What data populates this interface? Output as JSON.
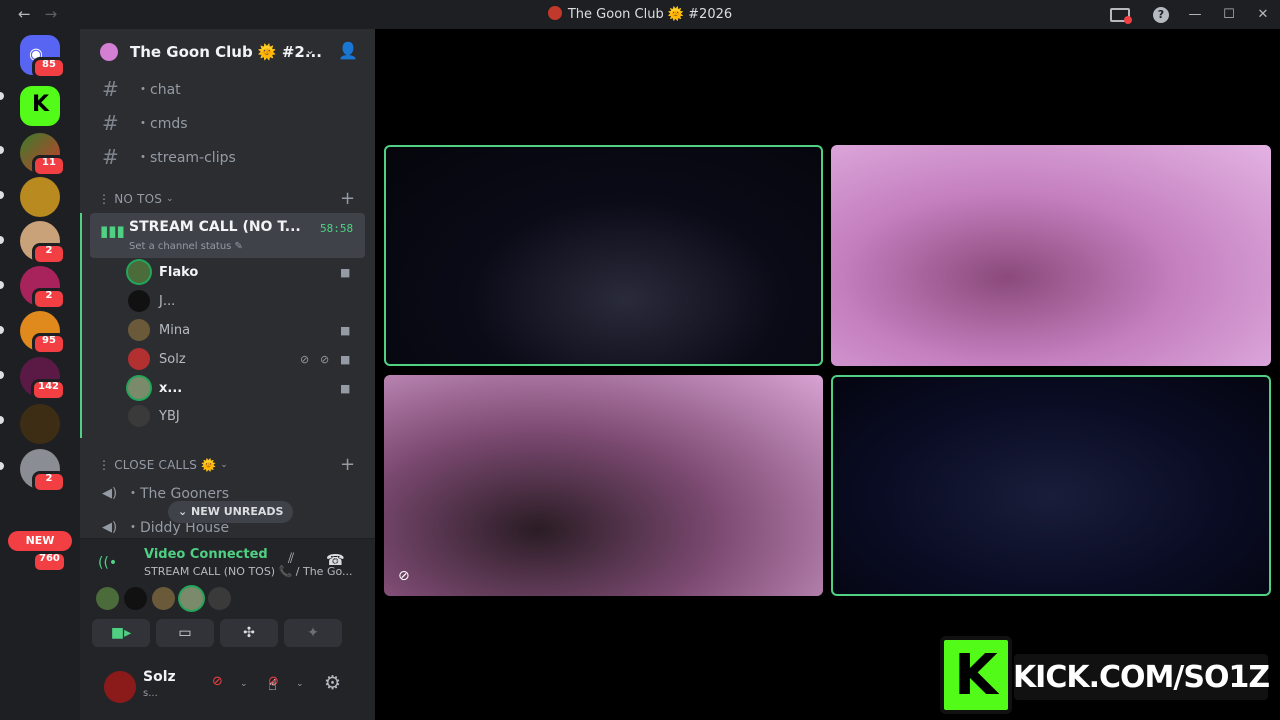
{
  "titlebar": {
    "back_label": "←",
    "forward_label": "→",
    "title": "The Goon Club 🌞 #2026",
    "help_label": "?",
    "minimize_label": "—",
    "maximize_label": "☐",
    "close_label": "✕"
  },
  "guilds": {
    "home_badge": "85",
    "badges": [
      "11",
      "2",
      "2",
      "95",
      "142",
      "2"
    ],
    "new_label": "NEW",
    "new_badge": "760"
  },
  "server": {
    "name": "The Goon Club 🌞 #2...",
    "channels": [
      {
        "label": "・chat"
      },
      {
        "label": "・cmds"
      },
      {
        "label": "・stream-clips"
      }
    ],
    "category_1": "⋮ NO TOS",
    "active_voice": {
      "title": "STREAM CALL (NO T...",
      "timer": "58:58",
      "status": "Set a channel status ✎"
    },
    "members": [
      {
        "name": "Flako"
      },
      {
        "name": "J..."
      },
      {
        "name": "Mina"
      },
      {
        "name": "Solz"
      },
      {
        "name": "x..."
      },
      {
        "name": "YBJ"
      }
    ],
    "category_2": "⋮ CLOSE CALLS 🌞",
    "voice_channels": [
      {
        "label": "・The Gooners"
      },
      {
        "label": "・Diddy House"
      }
    ],
    "new_unreads": "NEW UNREADS"
  },
  "voice_panel": {
    "state": "Video Connected",
    "subtitle": "STREAM CALL (NO TOS) 📞 / The Go..."
  },
  "user": {
    "name": "Solz",
    "status": "s..."
  },
  "overlay": {
    "kick_letter": "K",
    "kick_text": "KICK.COM/SO1Z"
  },
  "colors": {
    "accent_green": "#4fd083",
    "danger_red": "#f23f43",
    "kick_green": "#53fc18"
  }
}
